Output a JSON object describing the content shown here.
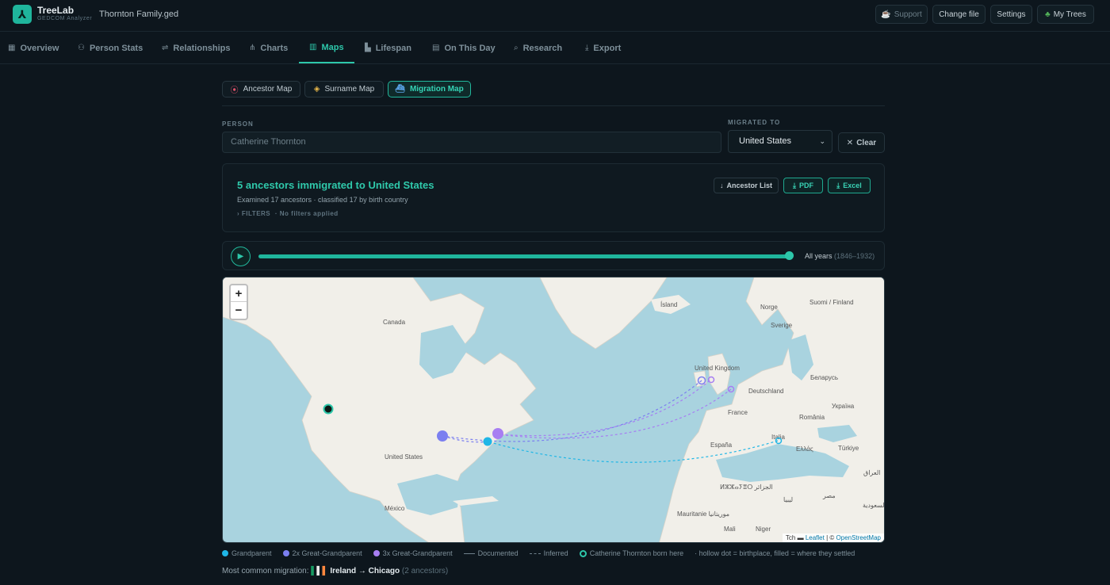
{
  "header": {
    "app_name": "TreeLab",
    "app_subtitle": "GEDCOM Analyzer",
    "file_name": "Thornton Family.ged",
    "buttons": {
      "support": "Support",
      "change_file": "Change file",
      "settings": "Settings",
      "my_trees": "My Trees"
    }
  },
  "tabs": [
    {
      "label": "Overview",
      "icon": "grid-icon"
    },
    {
      "label": "Person Stats",
      "icon": "person-icon"
    },
    {
      "label": "Relationships",
      "icon": "link-icon"
    },
    {
      "label": "Charts",
      "icon": "tree-icon"
    },
    {
      "label": "Maps",
      "icon": "map-icon",
      "active": true
    },
    {
      "label": "Lifespan",
      "icon": "bar-chart-icon"
    },
    {
      "label": "On This Day",
      "icon": "calendar-icon"
    },
    {
      "label": "Research",
      "icon": "search-icon"
    },
    {
      "label": "Export",
      "icon": "download-icon"
    }
  ],
  "map_tabs": [
    {
      "label": "Ancestor Map",
      "icon": "pin-icon"
    },
    {
      "label": "Surname Map",
      "icon": "tag-icon"
    },
    {
      "label": "Migration Map",
      "icon": "ship-icon",
      "active": true
    }
  ],
  "filters": {
    "person_label": "PERSON",
    "person_placeholder": "Catherine Thornton",
    "migrated_label": "MIGRATED TO",
    "migrated_value": "United States",
    "clear_label": "Clear"
  },
  "summary": {
    "title": "5 ancestors immigrated to United States",
    "subtitle": "Examined 17 ancestors · classified 17 by birth country",
    "filters_label": "FILTERS",
    "filters_value": "· No filters applied",
    "buttons": {
      "ancestor_list": "Ancestor List",
      "pdf": "PDF",
      "excel": "Excel"
    }
  },
  "timeline": {
    "label": "All years",
    "range": "(1846–1932)",
    "progress": 1.0
  },
  "map": {
    "zoom_in": "+",
    "zoom_out": "−",
    "place_labels": [
      "Canada",
      "United States",
      "México",
      "Ísland",
      "Norge",
      "Suomi / Finland",
      "Sverige",
      "United Kingdom",
      "Deutschland",
      "France",
      "España",
      "Italia",
      "Беларусь",
      "Україна",
      "România",
      "Ελλάς",
      "Türkiye",
      "العراق",
      "ⵍⵣⵣⴰⵢⴻⵔ الجزائر",
      "ليبيا",
      "مصر",
      "Mauritanie موريتانيا",
      "Mali",
      "Niger",
      "السعودية"
    ],
    "attribution_prefix": "Tch",
    "attribution_leaflet": "Leaflet",
    "attribution_sep": "| ©",
    "attribution_osm": "OpenStreetMap"
  },
  "legend": {
    "grandparent": "Grandparent",
    "great2": "2x Great-Grandparent",
    "great3": "3x Great-Grandparent",
    "documented": "Documented",
    "inferred": "Inferred",
    "born_here": "Catherine Thornton born here",
    "note": "· hollow dot = birthplace, filled = where they settled",
    "colors": {
      "grandparent": "#1fb6e6",
      "great2": "#7b7ff0",
      "great3": "#a77ef2"
    }
  },
  "common_migration": {
    "label": "Most common migration:",
    "route": "Ireland → Chicago",
    "count": "(2 ancestors)"
  }
}
